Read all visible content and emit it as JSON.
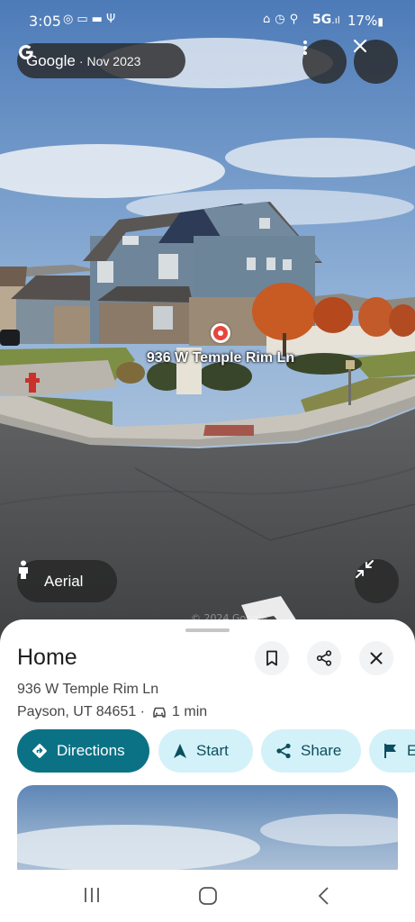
{
  "status_bar": {
    "time": "3:05",
    "left_icons": [
      "whatsapp-icon",
      "chat-icon",
      "folder-icon",
      "antenna-icon"
    ],
    "right_icons": [
      "tag-icon",
      "alarm-icon",
      "location-icon"
    ],
    "network": "5G",
    "battery": "17%"
  },
  "imagery": {
    "brand": "Google",
    "date": "Nov 2023"
  },
  "street_view": {
    "address_label": "936 W Temple Rim Ln",
    "aerial_label": "Aerial"
  },
  "place": {
    "title": "Home",
    "address": "936 W Temple Rim Ln",
    "city": "Payson, UT 84651",
    "travel_time": "1 min"
  },
  "actions": {
    "directions": "Directions",
    "start": "Start",
    "share": "Share",
    "more": "E"
  },
  "colors": {
    "primary": "#0b7285",
    "chip_bg": "#d3f1f8",
    "pin": "#e8453c"
  }
}
